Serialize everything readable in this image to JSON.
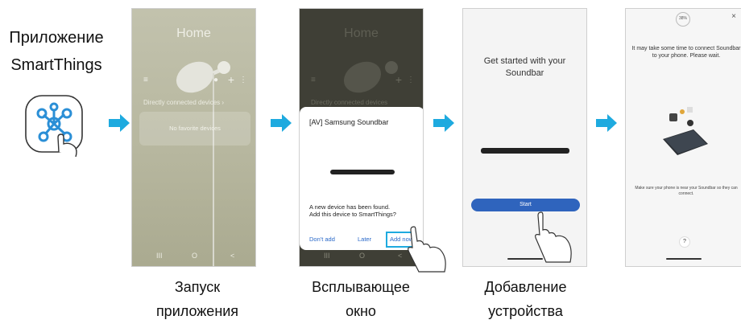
{
  "app": {
    "title_line1": "Приложение",
    "title_line2": "SmartThings"
  },
  "step1": {
    "screen_title": "Home",
    "section_label": "Directly connected devices  ›",
    "empty_card": "No favorite devices",
    "nav_recents": "III",
    "nav_home": "O",
    "nav_back": "<",
    "caption_line1": "Запуск",
    "caption_line2": "приложения"
  },
  "step2": {
    "screen_title": "Home",
    "section_label": "Directly connected devices",
    "popup_title": "[AV] Samsung Soundbar",
    "popup_message_line1": "A new device has been found.",
    "popup_message_line2": "Add this device to SmartThings?",
    "btn_dont_add": "Don't add",
    "btn_later": "Later",
    "btn_add_now": "Add now",
    "nav_recents": "III",
    "nav_home": "O",
    "nav_back": "<",
    "caption_line1": "Всплывающее",
    "caption_line2": "окно"
  },
  "step3": {
    "title_line1": "Get started with your",
    "title_line2": "Soundbar",
    "start_button": "Start",
    "caption_line1": "Добавление",
    "caption_line2": "устройства"
  },
  "step4": {
    "progress_label": "38%",
    "close": "×",
    "wait_message": "It may take some time to connect Soundbar to your phone. Please wait.",
    "near_message": "Make sure your phone is near your Soundbar so they can connect.",
    "help": "?"
  },
  "colors": {
    "arrow": "#1eaadf",
    "accent_blue": "#2f64bd",
    "icon_blue": "#2b8fd6"
  }
}
